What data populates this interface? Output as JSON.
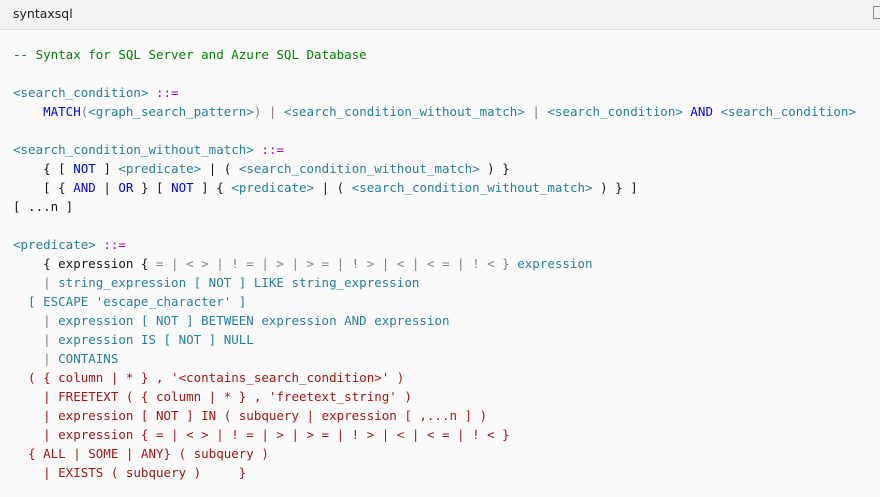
{
  "header": {
    "language": "syntaxsql"
  },
  "colors": {
    "background": "#fafafa",
    "header_background": "#f2f2f2",
    "comment": "#008000",
    "keyword": "#0000ff",
    "operator": "#808080",
    "parameter": "#267f99",
    "string": "#a31515",
    "special": "#b000b0",
    "text": "#161616"
  },
  "icons": {
    "copy": "copy-icon"
  },
  "code_lines": [
    [
      [
        "comment",
        "-- Syntax for SQL Server and Azure SQL Database"
      ]
    ],
    [],
    [
      [
        "param",
        "<search_condition>"
      ],
      [
        "text",
        " "
      ],
      [
        "special",
        "::="
      ]
    ],
    [
      [
        "text",
        "    "
      ],
      [
        "keyword",
        "MATCH"
      ],
      [
        "op",
        "("
      ],
      [
        "param",
        "<graph_search_pattern>"
      ],
      [
        "op",
        ")"
      ],
      [
        "text",
        " "
      ],
      [
        "op",
        "|"
      ],
      [
        "text",
        " "
      ],
      [
        "param",
        "<search_condition_without_match>"
      ],
      [
        "text",
        " "
      ],
      [
        "op",
        "|"
      ],
      [
        "text",
        " "
      ],
      [
        "param",
        "<search_condition>"
      ],
      [
        "text",
        " "
      ],
      [
        "keyword",
        "AND"
      ],
      [
        "text",
        " "
      ],
      [
        "param",
        "<search_condition>"
      ]
    ],
    [],
    [
      [
        "param",
        "<search_condition_without_match>"
      ],
      [
        "text",
        " "
      ],
      [
        "special",
        "::="
      ]
    ],
    [
      [
        "text",
        "    { [ "
      ],
      [
        "keyword",
        "NOT"
      ],
      [
        "text",
        " ] "
      ],
      [
        "param",
        "<predicate>"
      ],
      [
        "text",
        " | ( "
      ],
      [
        "param",
        "<search_condition_without_match>"
      ],
      [
        "text",
        " ) }"
      ]
    ],
    [
      [
        "text",
        "    [ { "
      ],
      [
        "keyword",
        "AND"
      ],
      [
        "text",
        " | "
      ],
      [
        "keyword",
        "OR"
      ],
      [
        "text",
        " } [ "
      ],
      [
        "keyword",
        "NOT"
      ],
      [
        "text",
        " ] { "
      ],
      [
        "param",
        "<predicate>"
      ],
      [
        "text",
        " | ( "
      ],
      [
        "param",
        "<search_condition_without_match>"
      ],
      [
        "text",
        " ) } ]"
      ]
    ],
    [
      [
        "text",
        "[ ...n ]"
      ]
    ],
    [],
    [
      [
        "param",
        "<predicate>"
      ],
      [
        "text",
        " "
      ],
      [
        "special",
        "::="
      ]
    ],
    [
      [
        "text",
        "    { expression { "
      ],
      [
        "op",
        "= | < > | ! = | > | > = | ! > | < | < = | ! < }"
      ],
      [
        "text",
        " "
      ],
      [
        "param",
        "expression"
      ]
    ],
    [
      [
        "op",
        "    | "
      ],
      [
        "param",
        "string_expression [ NOT ] LIKE string_expression"
      ]
    ],
    [
      [
        "param",
        "  [ ESCAPE 'escape_character' ]"
      ]
    ],
    [
      [
        "op",
        "    | "
      ],
      [
        "param",
        "expression [ NOT ] BETWEEN expression AND expression"
      ]
    ],
    [
      [
        "op",
        "    | "
      ],
      [
        "param",
        "expression IS [ NOT ] NULL"
      ]
    ],
    [
      [
        "op",
        "    | "
      ],
      [
        "param",
        "CONTAINS"
      ]
    ],
    [
      [
        "string",
        "  ( { column | * } , '<contains_search_condition>' )"
      ]
    ],
    [
      [
        "string",
        "    | FREETEXT ( { column | * } , 'freetext_string' )"
      ]
    ],
    [
      [
        "string",
        "    | expression [ NOT ] IN ( subquery | expression [ ,...n ] )"
      ]
    ],
    [
      [
        "string",
        "    | expression { = | < > | ! = | > | > = | ! > | < | < = | ! < }"
      ]
    ],
    [
      [
        "string",
        "  { ALL | SOME | ANY} ( subquery )"
      ]
    ],
    [
      [
        "string",
        "    | EXISTS ( subquery )     }"
      ]
    ]
  ]
}
